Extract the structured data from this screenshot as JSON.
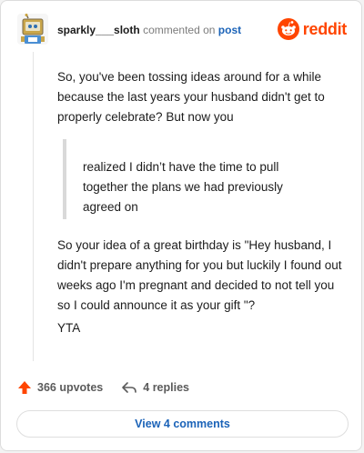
{
  "comment": {
    "username": "sparkly___sloth",
    "commented_text": "commented on",
    "post_link": "post",
    "paragraph_1": "So, you've been tossing ideas around for a while because the last years your husband didn't get to properly celebrate? But now you",
    "quote": "realized I didn’t have the time to pull together the plans we had previously agreed on",
    "paragraph_2": "So your idea of a great birthday is \"Hey husband, I didn't prepare anything for you but luckily I found out weeks ago I'm pregnant and decided to not tell you so I could announce it as your gift \"?",
    "paragraph_3": "YTA"
  },
  "brand": {
    "name": "reddit",
    "color": "#ff4500"
  },
  "actions": {
    "upvotes": "366 upvotes",
    "replies": "4 replies",
    "upvote_icon": "upvote-arrow-icon",
    "reply_icon": "reply-arrow-icon"
  },
  "footer": {
    "view_comments_label": "View 4 comments"
  },
  "colors": {
    "link": "#1b63b8",
    "upvote": "#ff4500",
    "muted": "#7c7c7c"
  }
}
